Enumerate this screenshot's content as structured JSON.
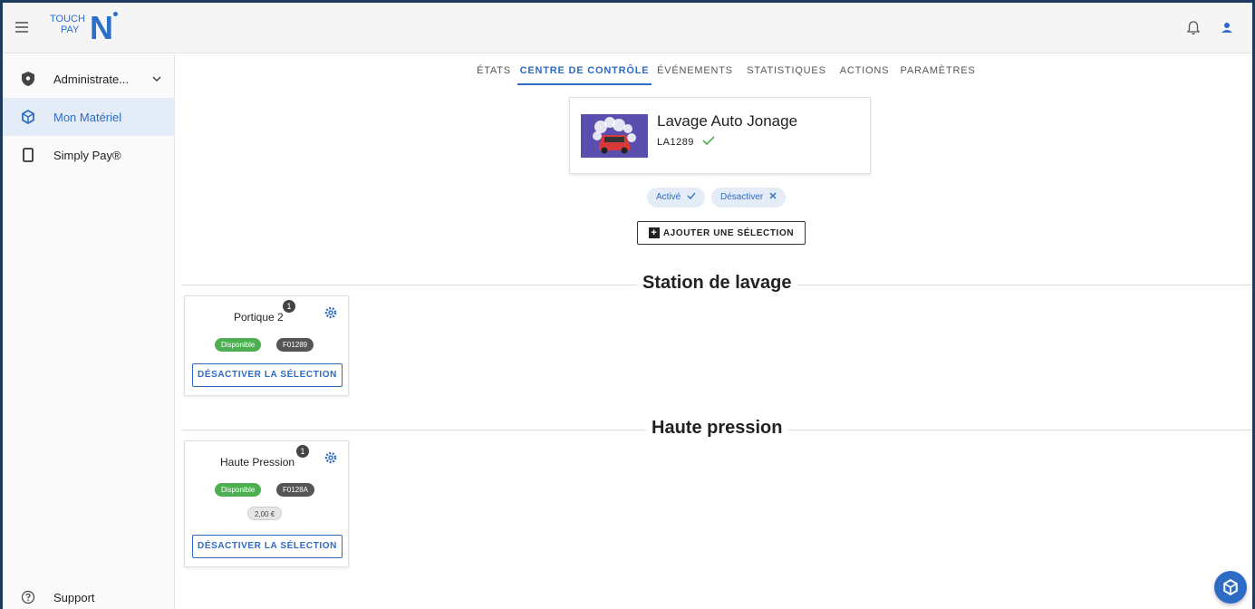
{
  "header": {
    "logo_line1": "TOUCH",
    "logo_line2": "PAY",
    "logo_mark": "N"
  },
  "sidebar": {
    "items": [
      {
        "label": "Administrate...",
        "icon": "shield-icon"
      },
      {
        "label": "Mon Matériel",
        "icon": "cube-icon"
      },
      {
        "label": "Simply Pay®",
        "icon": "phone-icon"
      }
    ],
    "support_label": "Support"
  },
  "tabs": [
    "ÉTATS",
    "CENTRE DE CONTRÔLE",
    "ÉVÉNEMENTS",
    "STATISTIQUES",
    "ACTIONS",
    "PARAMÈTRES"
  ],
  "active_tab": "CENTRE DE CONTRÔLE",
  "site": {
    "name": "Lavage Auto Jonage",
    "code": "LA1289"
  },
  "chips": {
    "active_label": "Activé",
    "deactivate_label": "Désactiver"
  },
  "add_selection_label": "AJOUTER UNE SÉLECTION",
  "sections": [
    {
      "title": "Station de lavage",
      "device": {
        "name": "Portique 2",
        "count": "1",
        "status": "Disponible",
        "id": "F01289",
        "button": "DÉSACTIVER LA SÉLECTION"
      }
    },
    {
      "title": "Haute pression",
      "device": {
        "name": "Haute Pression",
        "count": "1",
        "status": "Disponible",
        "id": "F0128A",
        "price": "2,00 €",
        "button": "DÉSACTIVER LA SÉLECTION"
      }
    }
  ],
  "colors": {
    "accent": "#2e6bc4",
    "success": "#4caf50",
    "frame": "#1f3a5f"
  }
}
